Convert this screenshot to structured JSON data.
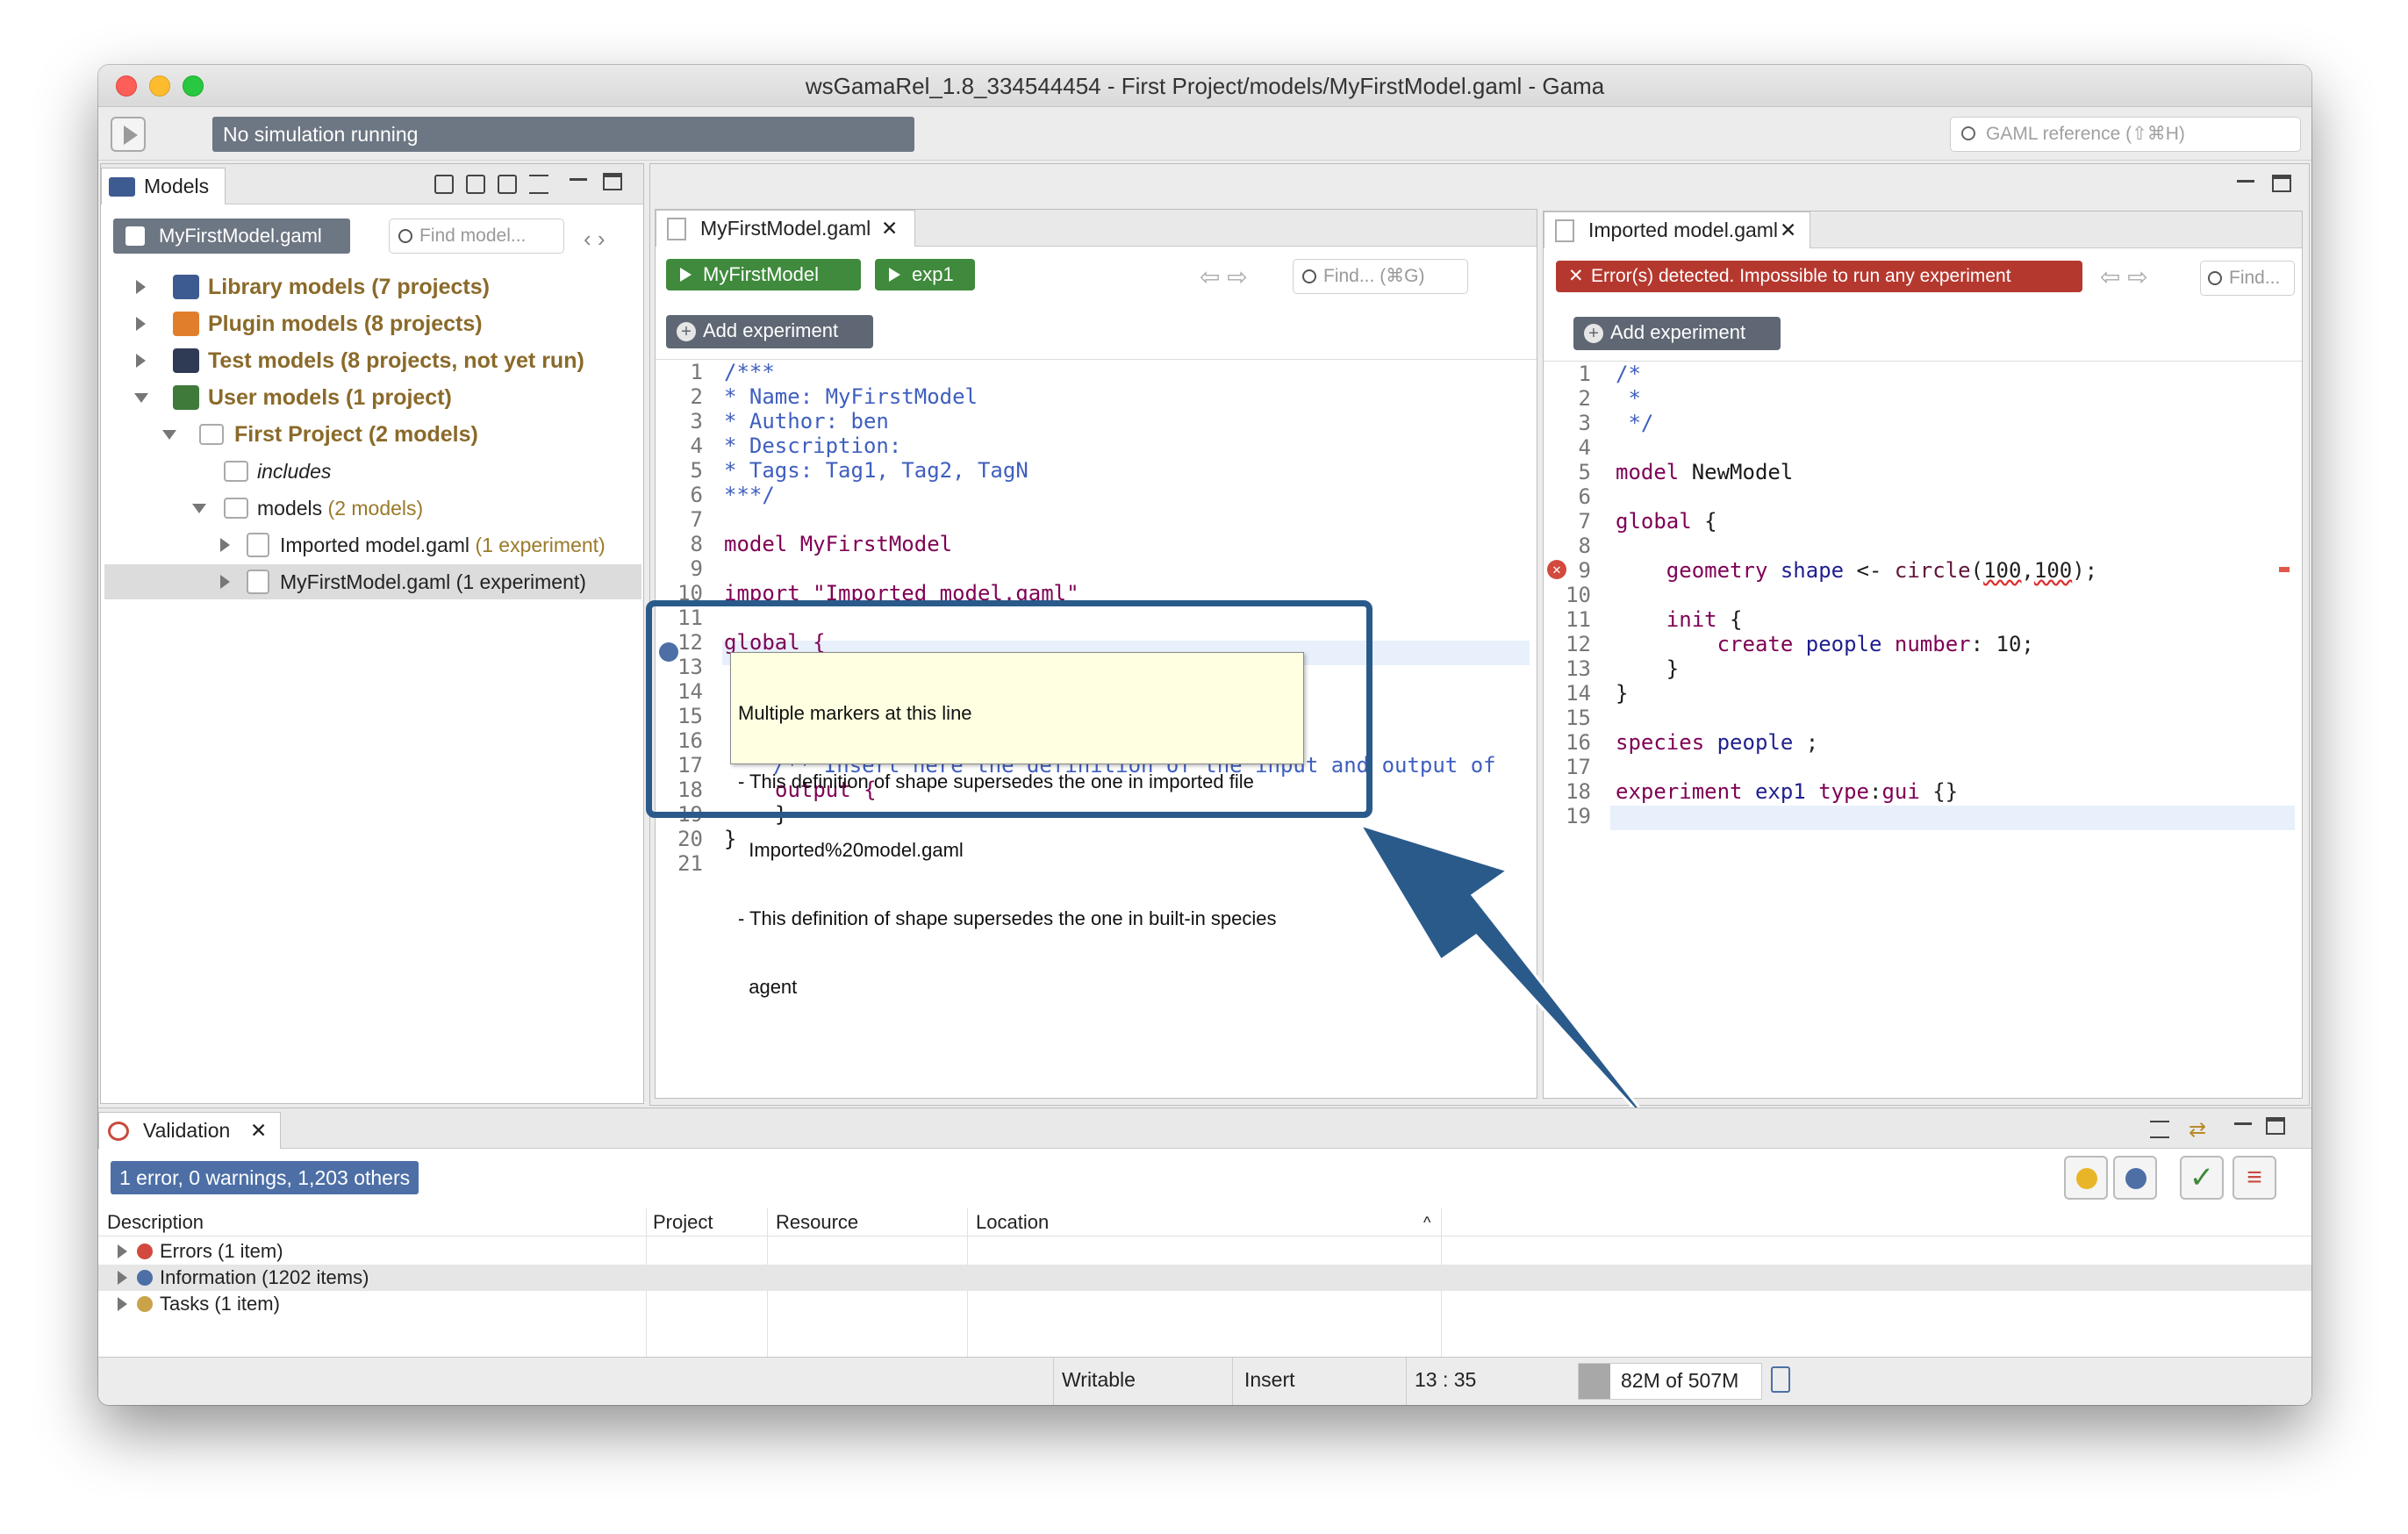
{
  "window": {
    "title": "wsGamaRel_1.8_334544454 - First Project/models/MyFirstModel.gaml - Gama"
  },
  "toolbar": {
    "sim_status": "No simulation running",
    "gaml_reference_placeholder": "GAML reference (⇧⌘H)"
  },
  "models_view": {
    "tab_label": "Models",
    "file_chip": "MyFirstModel.gaml",
    "find_placeholder": "Find model...",
    "tree": [
      {
        "label": "Library models",
        "count": "(7 projects)"
      },
      {
        "label": "Plugin models",
        "count": "(8 projects)"
      },
      {
        "label": "Test models",
        "count": "(8 projects, not yet run)"
      },
      {
        "label": "User models",
        "count": "(1 project)"
      },
      {
        "label": "First Project",
        "count": "(2 models)"
      },
      {
        "label": "includes",
        "count": ""
      },
      {
        "label": "models",
        "count": "(2 models)"
      },
      {
        "label": "Imported model.gaml",
        "count": "(1 experiment)"
      },
      {
        "label": "MyFirstModel.gaml",
        "count": "(1 experiment)"
      }
    ]
  },
  "editor_left": {
    "tab_label": "MyFirstModel.gaml",
    "buttons": [
      "MyFirstModel",
      "exp1"
    ],
    "find_placeholder": "Find... (⌘G)",
    "add_experiment": "Add experiment",
    "line_numbers": [
      "1",
      "2",
      "3",
      "4",
      "5",
      "6",
      "7",
      "8",
      "9",
      "10",
      "11",
      "12",
      "13",
      "14",
      "15",
      "16",
      "17",
      "18",
      "19",
      "20",
      "21"
    ],
    "lines": [
      "/***",
      "* Name: MyFirstModel",
      "* Author: ben",
      "* Description:",
      "* Tags: Tag1, Tag2, TagN",
      "***/",
      "",
      "model MyFirstModel",
      "",
      "import \"Imported model.gaml\"",
      "",
      "global {",
      "",
      "",
      "",
      "",
      "/** Insert here the definition of the input and output of",
      "output {",
      "}",
      "}",
      ""
    ],
    "tooltip": {
      "l1": "Multiple markers at this line",
      "l2": "- This definition of shape supersedes the one in imported file",
      "l3": "  Imported%20model.gaml",
      "l4": "- This definition of shape supersedes the one in built-in species",
      "l5": "  agent"
    },
    "partial_line_17": "d output of"
  },
  "editor_right": {
    "tab_label": "Imported model.gaml",
    "error_banner": "Error(s) detected. Impossible to run any experiment",
    "find_placeholder": "Find...",
    "add_experiment": "Add experiment",
    "line_numbers": [
      "1",
      "2",
      "3",
      "4",
      "5",
      "6",
      "7",
      "8",
      "9",
      "10",
      "11",
      "12",
      "13",
      "14",
      "15",
      "16",
      "17",
      "18",
      "19"
    ]
  },
  "validation": {
    "tab_label": "Validation",
    "summary": "1 error, 0 warnings, 1,203 others",
    "columns": [
      "Description",
      "Project",
      "Resource",
      "Location"
    ],
    "rows": [
      "Errors (1 item)",
      "Information (1202 items)",
      "Tasks (1 item)"
    ]
  },
  "status_bar": {
    "writable": "Writable",
    "insert": "Insert",
    "position": "13 : 35",
    "memory": "82M of 507M"
  },
  "colors": {
    "highlight": "#2a5a8a",
    "run_green": "#3f8a3c",
    "error_red": "#b5382f",
    "tree_label": "#8a6a2a"
  },
  "icons": [
    "play-icon",
    "search-icon",
    "folder-icon",
    "close-tab-icon",
    "minimize-icon",
    "maximize-icon",
    "error-icon",
    "info-icon",
    "task-icon",
    "trash-icon",
    "arrow-pointer"
  ]
}
